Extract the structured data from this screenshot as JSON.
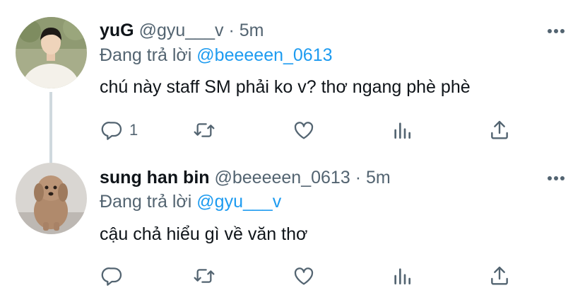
{
  "tweets": [
    {
      "display_name": "yuG",
      "handle": "@gyu___v",
      "separator": "·",
      "time": "5m",
      "reply_prefix": "Đang trả lời",
      "reply_to": "@beeeeen_0613",
      "text": "chú này staff SM phải ko v? thơ ngang phè phè",
      "reply_count": "1",
      "avatar": "man-in-white-shirt-photo"
    },
    {
      "display_name": "sung han bin",
      "handle": "@beeeeen_0613",
      "separator": "·",
      "time": "5m",
      "reply_prefix": "Đang trả lời",
      "reply_to": "@gyu___v",
      "text": "cậu chả hiểu gì về văn thơ",
      "reply_count": "",
      "avatar": "poodle-dog-photo"
    }
  ],
  "icons": [
    "reply-icon",
    "retweet-icon",
    "like-icon",
    "stats-icon",
    "share-icon",
    "more-icon"
  ],
  "colors": {
    "accent": "#1d9bf0",
    "secondary_text": "#536471",
    "primary_text": "#0f1419",
    "thread_line": "#cfd9de"
  }
}
